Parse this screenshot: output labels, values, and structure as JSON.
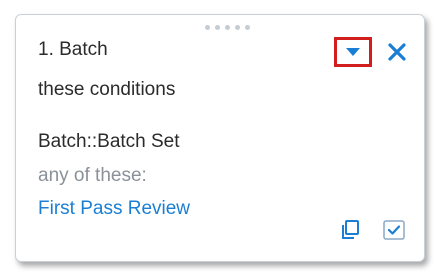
{
  "card": {
    "title": "1. Batch",
    "subtitle": "these conditions",
    "field": "Batch::Batch Set",
    "operator": "any of these:",
    "value": "First Pass Review"
  },
  "icons": {
    "drag": "drag-handle-icon",
    "dropdown": "caret-down-icon",
    "close": "close-icon",
    "copy": "copy-icon",
    "check": "checkbox-check-icon"
  },
  "colors": {
    "accent": "#1a7fd4",
    "highlight_border": "#d11f1f",
    "text": "#2b2b2b",
    "muted": "#8a9199"
  }
}
